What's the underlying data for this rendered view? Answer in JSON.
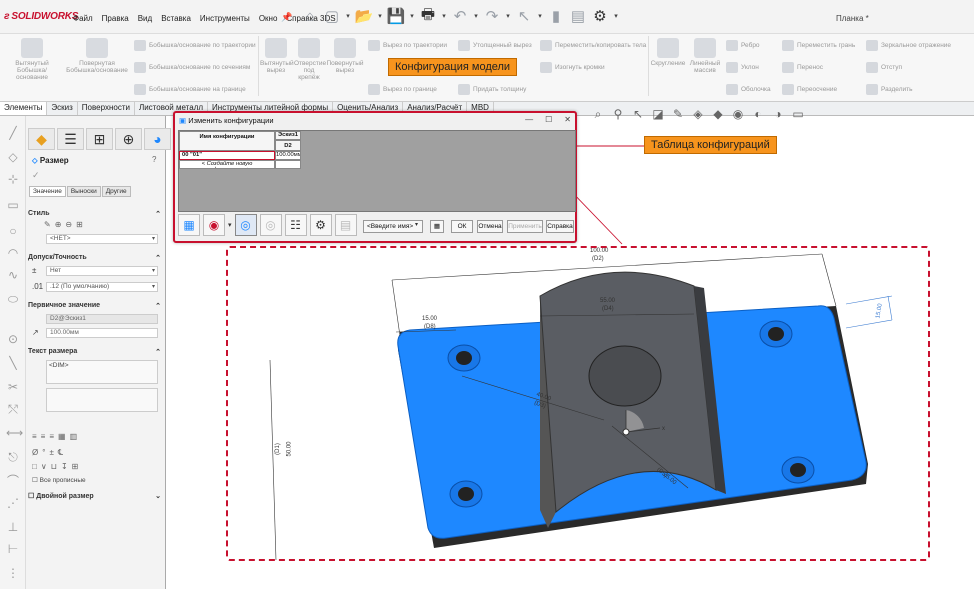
{
  "app": {
    "logo": "SOLIDWORKS",
    "doc_title": "Планка *"
  },
  "menu": [
    "Файл",
    "Правка",
    "Вид",
    "Вставка",
    "Инструменты",
    "Окно",
    "Справка 3DS"
  ],
  "ribbon": {
    "big_buttons": [
      "Вытянутый Бобышка/основание",
      "Повернутая Бобышка/основание",
      "Вытянутый вырез",
      "Отверстие под крепёж",
      "Повернутый вырез",
      "Скругление",
      "Линейный массив",
      "Ребро",
      "Уклон",
      "Оболочка"
    ],
    "rows": [
      "Бобышка/основание по траектории",
      "Бобышка/основание по сечениям",
      "Бобышка/основание на границе",
      "Вырез по траектории",
      "Вырез по сечениям",
      "Вырез по границе",
      "Утолщенный вырез",
      "Придать толщину",
      "Переместить/копировать тела",
      "Изогнуть кромки",
      "Переместить грань",
      "Перенос",
      "Переосчение",
      "Зеркальное отражение",
      "Отступ",
      "Разделить"
    ]
  },
  "tabs": [
    "Элементы",
    "Эскиз",
    "Поверхности",
    "Листовой металл",
    "Инструменты литейной формы",
    "Оценить/Анализ",
    "Анализ/Расчёт",
    "MBD"
  ],
  "property_manager": {
    "title": "Размер",
    "tabs": [
      "Значение",
      "Выноски",
      "Другие"
    ],
    "style_section": "Стиль",
    "style_value": "<НЕТ>",
    "tolerance_section": "Допуск/Точность",
    "tolerance_value": "Нет",
    "precision_value": ".12 (По умолчанию)",
    "primary_section": "Первичное значение",
    "primary_name": "D2@Эскиз1",
    "primary_value": "100.00мм",
    "dimtext_section": "Текст размера",
    "dimtext_value": "<DIM>",
    "all_caps": "Все прописные",
    "dual_dim": "Двойной размер"
  },
  "dialog": {
    "title": "Изменить конфигурации",
    "col_config": "Имя конфигурации",
    "col_sketch": "Эскиз1",
    "col_d2": "D2",
    "row_name": "00 \"01\"",
    "row_value": "100.00мм",
    "new_row": "< Создайте новую конфигурацию. >",
    "view_placeholder": "<Введите имя>",
    "ok": "ОК",
    "cancel": "Отмена",
    "apply": "Применить",
    "help": "Справка"
  },
  "annotations": {
    "config": "Конфигурация модели",
    "table": "Таблица конфигураций"
  },
  "dimensions": {
    "d2": "100.00",
    "d2_tag": "(D2)",
    "d4": "55.00",
    "d4_tag": "(D4)",
    "d8": "15.00",
    "d8_tag": "(D8)",
    "d1": "50.00",
    "d1_tag": "(D1)",
    "d3": "40.00",
    "d3_tag": "(D3)",
    "d5": "25.00",
    "d5_tag": "(D5)",
    "d6": "15.00"
  },
  "colors": {
    "brand": "#c8102e",
    "part": "#1e88ff",
    "annotation": "#f7941d"
  }
}
